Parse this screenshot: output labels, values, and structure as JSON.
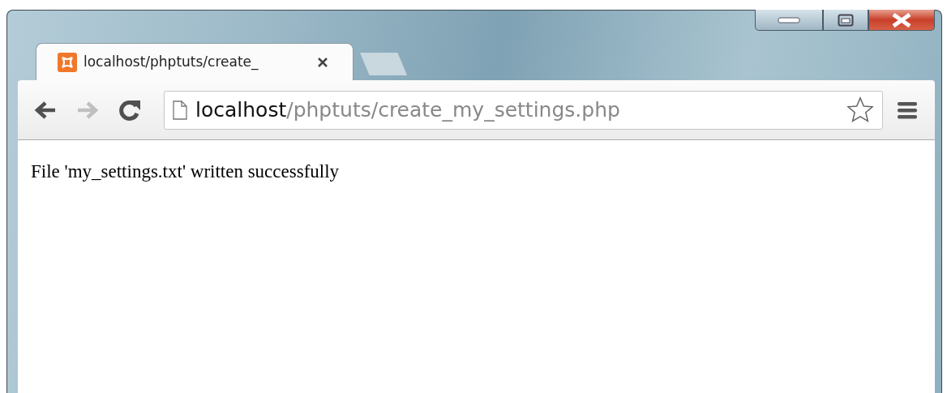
{
  "tabs": [
    {
      "title": "localhost/phptuts/create_",
      "selected": true
    }
  ],
  "toolbar": {
    "back_disabled": false,
    "forward_disabled": true
  },
  "address": {
    "host": "localhost",
    "path": "/phptuts/create_my_settings.php"
  },
  "content": {
    "text": "File 'my_settings.txt' written successfully"
  }
}
